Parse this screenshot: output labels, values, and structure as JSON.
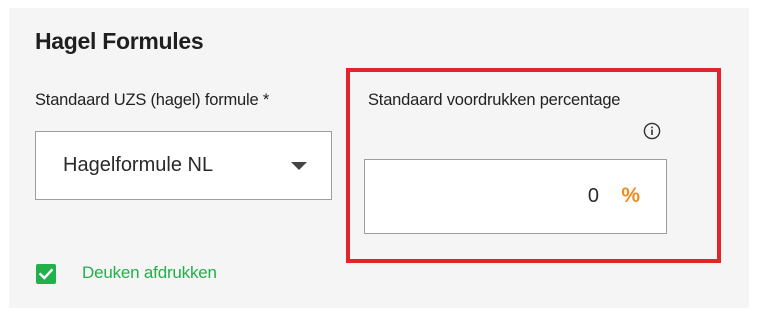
{
  "section": {
    "title": "Hagel Formules"
  },
  "formula_field": {
    "label": "Standaard UZS (hagel) formule *",
    "selected_value": "Hagelformule NL",
    "icon": "chevron-down-icon"
  },
  "percentage_field": {
    "label": "Standaard voordrukken percentage",
    "info_icon": "info-icon",
    "value": "0",
    "unit": "%",
    "unit_color": "#f08c1e"
  },
  "dents_option": {
    "label": "Deuken afdrukken",
    "checked": true,
    "color": "#22b04b"
  },
  "highlight_color": "#e3252b"
}
